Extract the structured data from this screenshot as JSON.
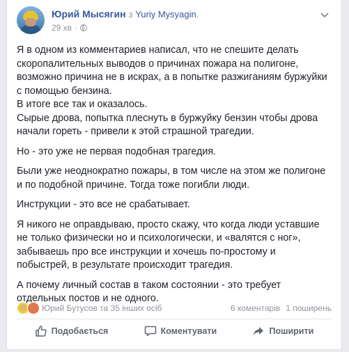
{
  "post": {
    "author": "Юрий Мысягин",
    "via": "з",
    "alias": "Yuriy Mysyagin",
    "period": ".",
    "time": "29 хв",
    "dot": "·",
    "paragraphs": [
      [
        "Я в одном из комментариев написал, что не спешите делать",
        "скоропалительных выводов о причинах пожара на полигоне,",
        "возможно причина не в искрах, а в попытке разжиганиям буржуйки",
        "с помощью бензина.",
        "В итоге все так и оказалось.",
        "Сырые дрова, попытка плеснуть в буржуйку бензин чтобы дрова",
        "начали гореть - привели к этой страшной трагедии."
      ],
      [
        "Но - это уже не первая подобная трагедия."
      ],
      [
        "Были уже неоднократно пожары, в том числе на этом же полигоне",
        "и по подобной причине. Тогда тоже погибли люди."
      ],
      [
        "Инструкции - это все не срабатывает."
      ],
      [
        "Я никого не оправдываю, просто скажу, что когда люди уставшие",
        "не только физически но и психологически, и «валятся с ног»,",
        "забываешь про все инструкции и хочешь по-простому и",
        "побыстрей, в результате происходит трагедия."
      ],
      [
        "А почему личный состав в таком состоянии - это требует",
        "отдельных постов и не одного."
      ]
    ]
  },
  "stats": {
    "reactors": "Юрий Бутусов та 35 інших осіб",
    "comments": "6 коментарів",
    "shares": "1 поширень",
    "reaction_icons": [
      "sad-reaction",
      "angry-reaction"
    ]
  },
  "actions": {
    "like": "Подобається",
    "comment": "Коментувати",
    "share": "Поширити"
  },
  "colors": {
    "link": "#365899",
    "muted": "#90949c",
    "action": "#616770",
    "background": "#e9ebee"
  }
}
